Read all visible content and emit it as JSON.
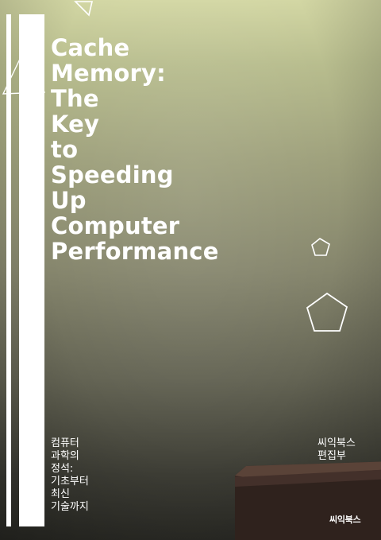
{
  "cover": {
    "title_lines": [
      "Cache",
      "Memory:",
      "The",
      "Key",
      "to",
      "Speeding",
      "Up",
      "Computer",
      "Performance"
    ],
    "subtitle_lines": [
      "컴퓨터",
      "과학의",
      "정석:",
      "기초부터",
      "최신",
      "기술까지"
    ],
    "author_lines": [
      "씨익북스",
      "편집부"
    ],
    "publisher": "씨익북스",
    "colors": {
      "background_top": "#d3d7a4",
      "background_bottom": "#2a2a25",
      "text": "#ffffff"
    }
  }
}
